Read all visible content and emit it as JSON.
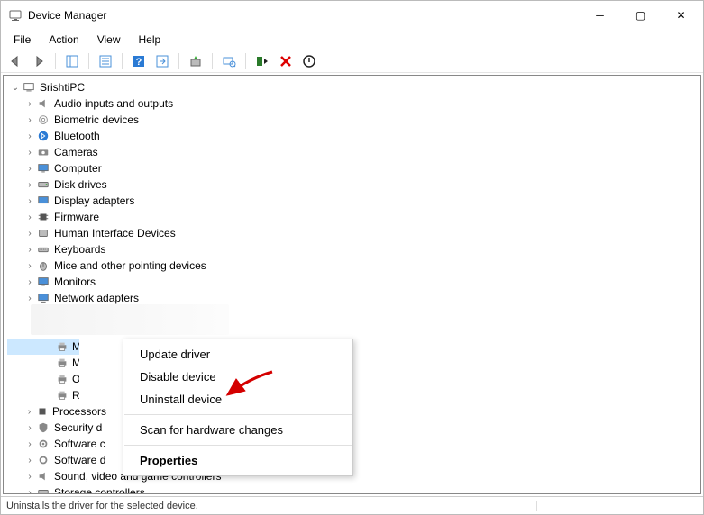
{
  "window": {
    "title": "Device Manager"
  },
  "window_controls": {
    "min": "─",
    "max": "▢",
    "close": "✕"
  },
  "menubar": {
    "file": "File",
    "action": "Action",
    "view": "View",
    "help": "Help"
  },
  "tree": {
    "root": "SrishtiPC",
    "cat_audio": "Audio inputs and outputs",
    "cat_biometric": "Biometric devices",
    "cat_bluetooth": "Bluetooth",
    "cat_cameras": "Cameras",
    "cat_computer": "Computer",
    "cat_disk": "Disk drives",
    "cat_display": "Display adapters",
    "cat_firmware": "Firmware",
    "cat_hid": "Human Interface Devices",
    "cat_keyboards": "Keyboards",
    "cat_mice": "Mice and other pointing devices",
    "cat_monitors": "Monitors",
    "cat_network": "Network adapters",
    "child_sel": "Micros",
    "child_2": "Micros",
    "child_3": "OneN",
    "child_4": "Root P",
    "cat_processors": "Processors",
    "cat_security": "Security d",
    "cat_software_c": "Software c",
    "cat_software_d": "Software d",
    "cat_sound": "Sound, video and game controllers",
    "cat_storage": "Storage controllers"
  },
  "context_menu": {
    "update": "Update driver",
    "disable": "Disable device",
    "uninstall": "Uninstall device",
    "scan": "Scan for hardware changes",
    "properties": "Properties"
  },
  "statusbar": {
    "text": "Uninstalls the driver for the selected device."
  }
}
